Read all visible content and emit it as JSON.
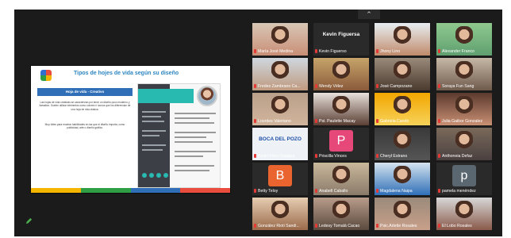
{
  "window": {
    "collapse_icon": "chevron-up-icon"
  },
  "share": {
    "title": "Tipos de hojes de vida según su diseño",
    "subtitle": "Hoja de vida - Creativo",
    "paragraph1": "Las hojas de vida creativas se caracterizan por tener un diseño poco moderno y llamativo. Suelen utilizar elementos como colores e íconos que los diferencian de una hoja de vida clásica.",
    "paragraph2": "Muy útiles para mostrar habilidades en las que el diseño importa, como publicidad, arte o diseño gráfico.",
    "bottom_colors": [
      "#f5b400",
      "#2f9e44",
      "#2e6fb7",
      "#e84d3d"
    ]
  },
  "participants": [
    {
      "name": "María José Medina",
      "kind": "video",
      "colors": [
        "#d8c7b6",
        "#c98e76"
      ]
    },
    {
      "name": "Kevin Figuerso",
      "kind": "text",
      "label": "Kevin Figuersa",
      "colors": [
        "#2a2a2a",
        "#2a2a2a"
      ]
    },
    {
      "name": "Jhony Lino",
      "kind": "video",
      "colors": [
        "#e8eef2",
        "#c08a6a"
      ]
    },
    {
      "name": "Alexander Franco",
      "kind": "video",
      "colors": [
        "#8fc98f",
        "#5f9f6f"
      ]
    },
    {
      "name": "Fredes Zambrano Ca...",
      "kind": "video",
      "colors": [
        "#cfd7df",
        "#bf9a7f"
      ]
    },
    {
      "name": "Wendy Vélez",
      "kind": "video",
      "colors": [
        "#c7a46a",
        "#8a5a3a"
      ]
    },
    {
      "name": "José Campozano",
      "kind": "video",
      "colors": [
        "#9a8a7a",
        "#4a3a2f"
      ]
    },
    {
      "name": "Soraya Fun Sang",
      "kind": "video",
      "colors": [
        "#c6b8a6",
        "#6f5a4b"
      ]
    },
    {
      "name": "Lourdes Valeriano",
      "kind": "video",
      "colors": [
        "#b9a08a",
        "#d2b49c"
      ]
    },
    {
      "name": "Psi. Paulette Macay",
      "kind": "video",
      "colors": [
        "#e7e1dc",
        "#5a3e33"
      ]
    },
    {
      "name": "Gabriela Cando",
      "kind": "video",
      "colors": [
        "#f2a600",
        "#f7d35a"
      ]
    },
    {
      "name": "Julia Gaibor Gonzalez",
      "kind": "video",
      "colors": [
        "#5b3a2e",
        "#c98f73"
      ]
    },
    {
      "name": "Kevin Piero Guagua",
      "kind": "text",
      "label": "BOCA DEL POZO",
      "colors": [
        "#eef2f6",
        "#1f4fa8"
      ]
    },
    {
      "name": "Priscilla Vinces",
      "kind": "letter",
      "label": "P",
      "colors": [
        "#e6487a",
        "#e6487a"
      ]
    },
    {
      "name": "Cheryl Estrano",
      "kind": "video",
      "colors": [
        "#3a3a3a",
        "#555555"
      ]
    },
    {
      "name": "Anthoneia Defaz",
      "kind": "video",
      "colors": [
        "#7a6a5a",
        "#4a4040"
      ]
    },
    {
      "name": "Betty Teloy",
      "kind": "letter",
      "label": "B",
      "colors": [
        "#e9642e",
        "#e9642e"
      ]
    },
    {
      "name": "Anabell Caballo",
      "kind": "video",
      "colors": [
        "#c9b89a",
        "#8a7a6a"
      ]
    },
    {
      "name": "Magdalena Naipa",
      "kind": "video",
      "colors": [
        "#d5e3ef",
        "#2f6fb7"
      ]
    },
    {
      "name": "pamela menéndez",
      "kind": "letter",
      "label": "p",
      "colors": [
        "#5a6670",
        "#5a6670"
      ]
    },
    {
      "name": "González Rioti Sandi...",
      "kind": "video",
      "colors": [
        "#e6cdb2",
        "#9a6a4a"
      ]
    },
    {
      "name": "Ledesy Tomalá Cacao",
      "kind": "video",
      "colors": [
        "#b89c8a",
        "#5a4a3e"
      ]
    },
    {
      "name": "Psic.Arlette Rosales",
      "kind": "video",
      "colors": [
        "#9a8a7a",
        "#c9a08a"
      ]
    },
    {
      "name": "El Lobo Rosales",
      "kind": "video",
      "colors": [
        "#d8d8d8",
        "#8a5a4a"
      ]
    }
  ]
}
